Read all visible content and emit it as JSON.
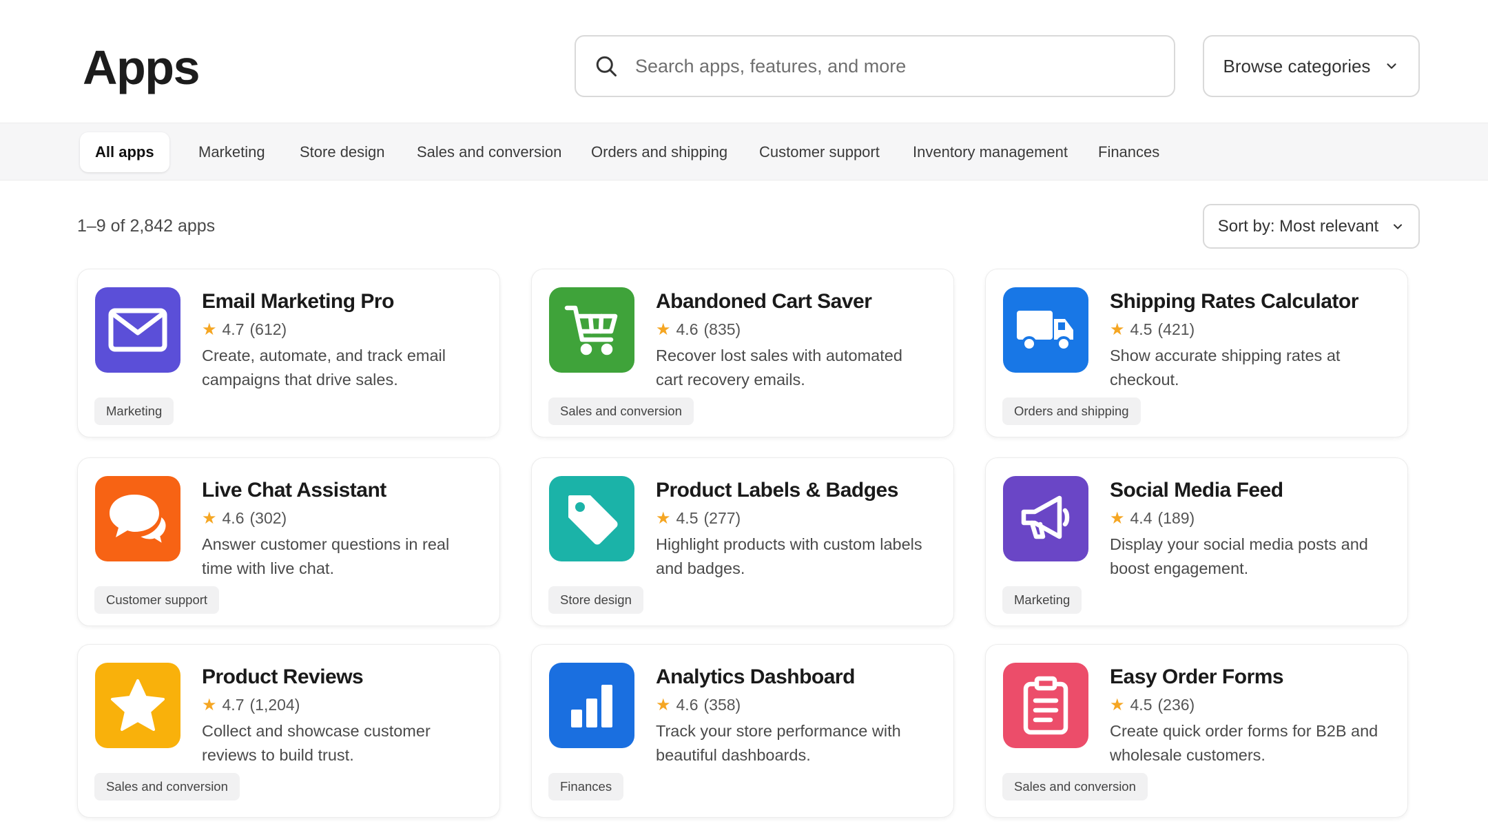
{
  "header": {
    "title": "Apps",
    "search_placeholder": "Search apps, features, and more",
    "browse_label": "Browse categories"
  },
  "tabs": [
    {
      "label": "All apps",
      "active": true
    },
    {
      "label": "Marketing",
      "active": false
    },
    {
      "label": "Store design",
      "active": false
    },
    {
      "label": "Sales and conversion",
      "active": false
    },
    {
      "label": "Orders and shipping",
      "active": false
    },
    {
      "label": "Customer support",
      "active": false
    },
    {
      "label": "Inventory management",
      "active": false
    },
    {
      "label": "Finances",
      "active": false
    }
  ],
  "results": {
    "count_text": "1–9 of 2,842 apps",
    "sort_label": "Sort by: Most relevant"
  },
  "apps": [
    {
      "name": "Email Marketing Pro",
      "rating": "4.7",
      "reviews": "(612)",
      "description": "Create, automate, and track email campaigns that drive sales.",
      "tag": "Marketing",
      "icon": "envelope-icon",
      "color": "#5b4fd8"
    },
    {
      "name": "Abandoned Cart Saver",
      "rating": "4.6",
      "reviews": "(835)",
      "description": "Recover lost sales with automated cart recovery emails.",
      "tag": "Sales and conversion",
      "icon": "cart-icon",
      "color": "#3fa33a"
    },
    {
      "name": "Shipping Rates Calculator",
      "rating": "4.5",
      "reviews": "(421)",
      "description": "Show accurate shipping rates at checkout.",
      "tag": "Orders and shipping",
      "icon": "truck-icon",
      "color": "#1877e6"
    },
    {
      "name": "Live Chat Assistant",
      "rating": "4.6",
      "reviews": "(302)",
      "description": "Answer customer questions in real time with live chat.",
      "tag": "Customer support",
      "icon": "chat-bubbles-icon",
      "color": "#f76314"
    },
    {
      "name": "Product Labels & Badges",
      "rating": "4.5",
      "reviews": "(277)",
      "description": "Highlight products with custom labels and badges.",
      "tag": "Store design",
      "icon": "price-tag-icon",
      "color": "#1bb3a8"
    },
    {
      "name": "Social Media Feed",
      "rating": "4.4",
      "reviews": "(189)",
      "description": "Display your social media posts and boost engagement.",
      "tag": "Marketing",
      "icon": "megaphone-icon",
      "color": "#6a46c6"
    },
    {
      "name": "Product Reviews",
      "rating": "4.7",
      "reviews": "(1,204)",
      "description": "Collect and showcase customer reviews to build trust.",
      "tag": "Sales and conversion",
      "icon": "star-icon",
      "color": "#f9b10b"
    },
    {
      "name": "Analytics Dashboard",
      "rating": "4.6",
      "reviews": "(358)",
      "description": "Track your store performance with beautiful dashboards.",
      "tag": "Finances",
      "icon": "bar-chart-icon",
      "color": "#1a6fe0"
    },
    {
      "name": "Easy Order Forms",
      "rating": "4.5",
      "reviews": "(236)",
      "description": "Create quick order forms for B2B and wholesale customers.",
      "tag": "Sales and conversion",
      "icon": "clipboard-icon",
      "color": "#ec4d6a"
    }
  ]
}
